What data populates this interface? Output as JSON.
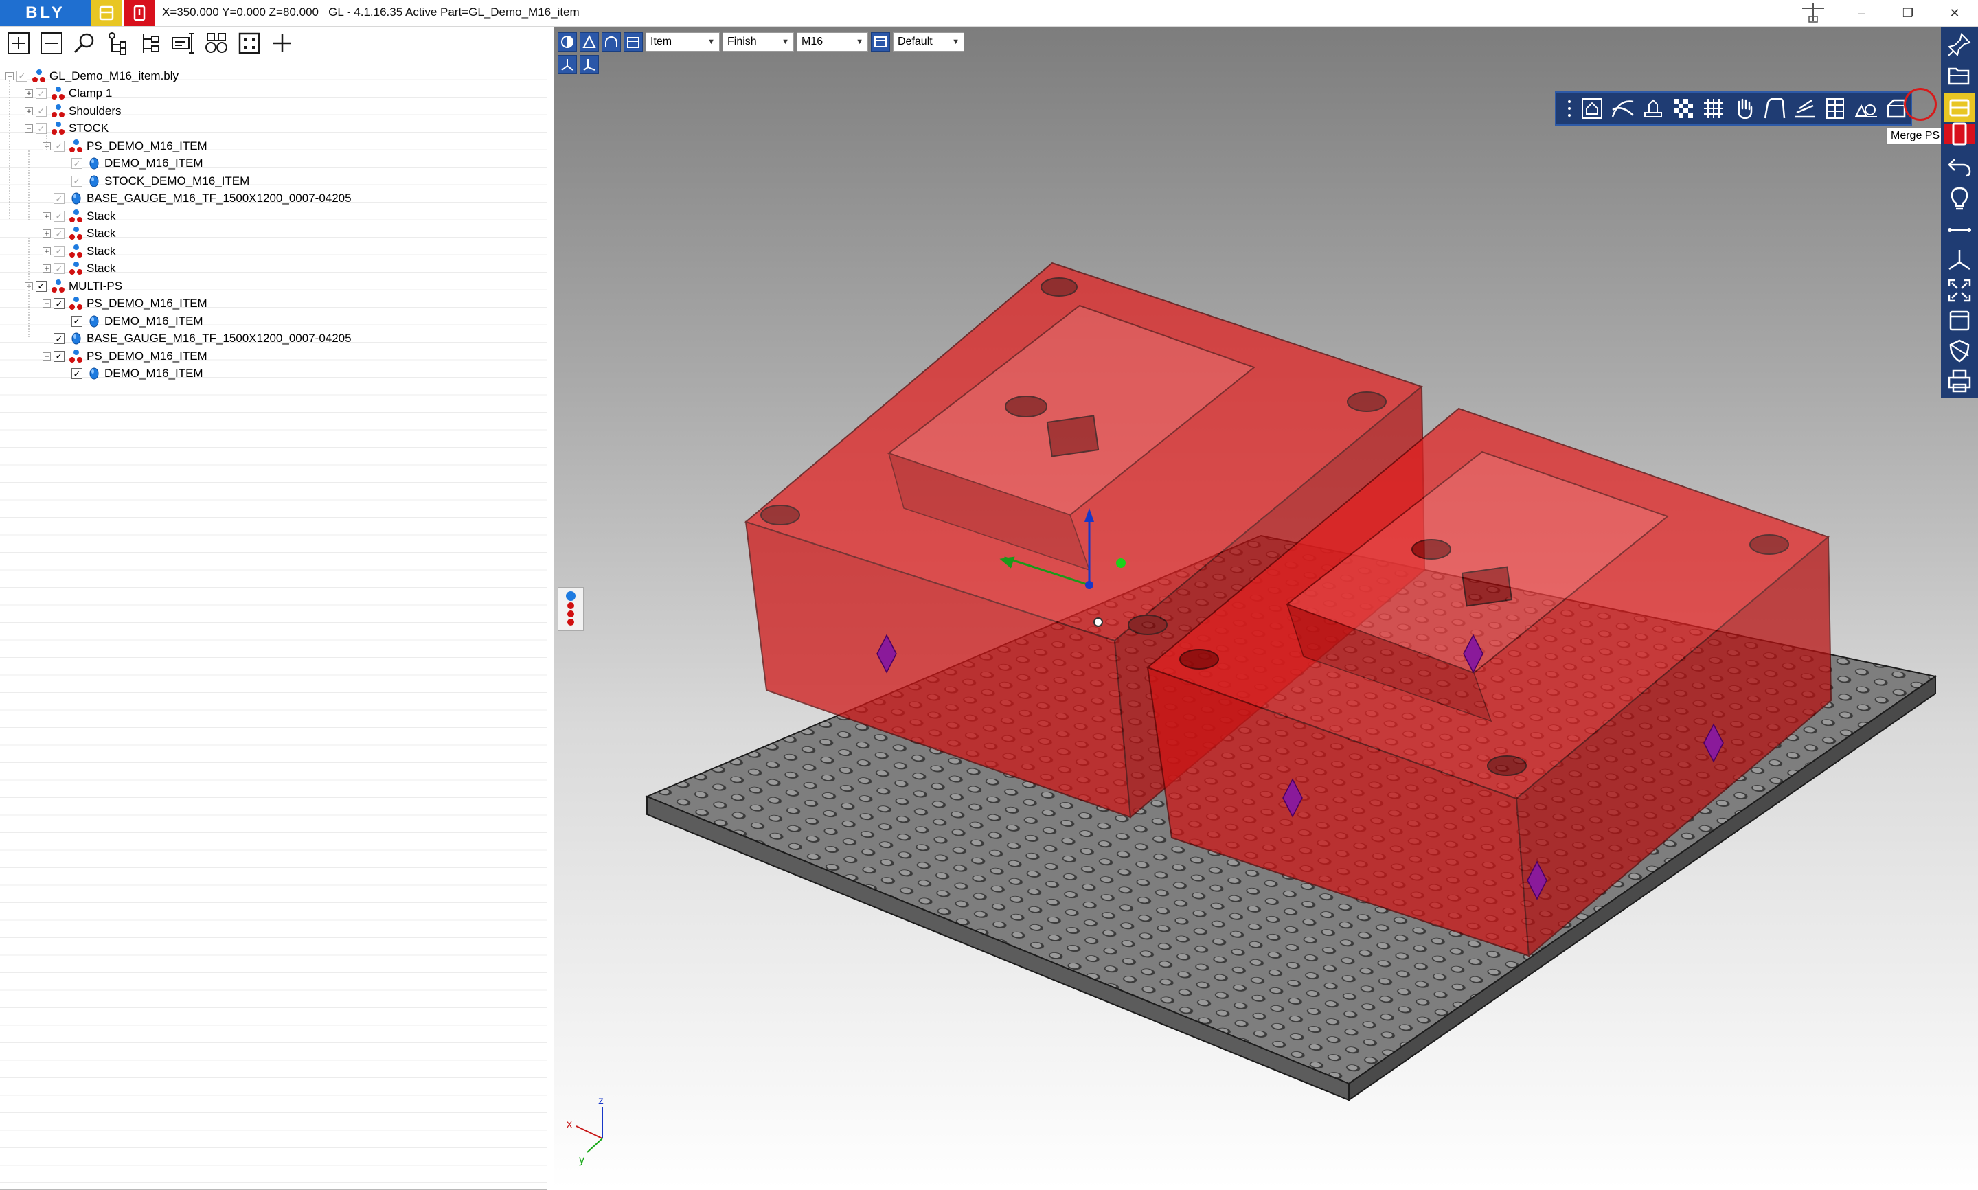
{
  "app": {
    "logo_text": "BLY",
    "status_line": "X=350.000 Y=0.000 Z=80.000   GL - 4.1.16.35 Active Part=GL_Demo_M16_item",
    "window_controls": {
      "minimize": "–",
      "restore": "❐",
      "close": "✕"
    }
  },
  "tree_toolbar": {
    "icons": [
      "expand-all-icon",
      "collapse-all-icon",
      "search-icon",
      "tree-select-icon",
      "tree-assign-icon",
      "edit-icon",
      "binoculars-icon",
      "fit-icon",
      "add-icon"
    ]
  },
  "tree": {
    "nodes": [
      {
        "label": "GL_Demo_M16_item.bly",
        "level": 0,
        "expand": "−",
        "checked": false,
        "icon": "assembly"
      },
      {
        "label": "Clamp 1",
        "level": 1,
        "expand": "+",
        "checked": false,
        "icon": "assembly"
      },
      {
        "label": "Shoulders",
        "level": 1,
        "expand": "+",
        "checked": false,
        "icon": "assembly"
      },
      {
        "label": "STOCK",
        "level": 1,
        "expand": "−",
        "checked": false,
        "icon": "assembly"
      },
      {
        "label": "PS_DEMO_M16_ITEM",
        "level": 2,
        "expand": "−",
        "checked": false,
        "icon": "assembly"
      },
      {
        "label": "DEMO_M16_ITEM",
        "level": 3,
        "expand": "",
        "checked": false,
        "icon": "part"
      },
      {
        "label": "STOCK_DEMO_M16_ITEM",
        "level": 3,
        "expand": "",
        "checked": false,
        "icon": "part"
      },
      {
        "label": "BASE_GAUGE_M16_TF_1500X1200_0007-04205",
        "level": 2,
        "expand": "",
        "checked": false,
        "icon": "part"
      },
      {
        "label": "Stack",
        "level": 2,
        "expand": "+",
        "checked": false,
        "icon": "assembly"
      },
      {
        "label": "Stack",
        "level": 2,
        "expand": "+",
        "checked": false,
        "icon": "assembly"
      },
      {
        "label": "Stack",
        "level": 2,
        "expand": "+",
        "checked": false,
        "icon": "assembly"
      },
      {
        "label": "Stack",
        "level": 2,
        "expand": "+",
        "checked": false,
        "icon": "assembly"
      },
      {
        "label": "MULTI-PS",
        "level": 1,
        "expand": "−",
        "checked": true,
        "icon": "assembly"
      },
      {
        "label": "PS_DEMO_M16_ITEM",
        "level": 2,
        "expand": "−",
        "checked": true,
        "icon": "assembly"
      },
      {
        "label": "DEMO_M16_ITEM",
        "level": 3,
        "expand": "",
        "checked": true,
        "icon": "part"
      },
      {
        "label": "BASE_GAUGE_M16_TF_1500X1200_0007-04205",
        "level": 2,
        "expand": "",
        "checked": true,
        "icon": "part"
      },
      {
        "label": "PS_DEMO_M16_ITEM",
        "level": 2,
        "expand": "−",
        "checked": true,
        "icon": "assembly"
      },
      {
        "label": "DEMO_M16_ITEM",
        "level": 3,
        "expand": "",
        "checked": true,
        "icon": "part"
      }
    ]
  },
  "viewport_toolbar": {
    "combos": [
      {
        "value": "Item"
      },
      {
        "value": "Finish"
      },
      {
        "value": "M16"
      },
      {
        "value": "Default"
      }
    ]
  },
  "floating_toolbar": {
    "icons": [
      "grip-icon",
      "fixture-icon",
      "curves-icon",
      "clamp-icon",
      "checker-icon",
      "grid-icon",
      "hand-icon",
      "profile-icon",
      "layers-icon",
      "table-icon",
      "shapes-icon",
      "merge-ps-icon"
    ],
    "tooltip": "Merge PS"
  },
  "right_toolbar": {
    "icons": [
      "pin-icon",
      "open-folder-icon",
      "yellow-panel-icon",
      "red-panel-icon",
      "undo-icon",
      "lightbulb-icon",
      "measure-icon",
      "axes-icon",
      "fit-view-icon",
      "window-icon",
      "shield-icon",
      "print-icon"
    ]
  },
  "axes": {
    "x": "x",
    "y": "y",
    "z": "z"
  },
  "colors": {
    "brand_blue": "#1f6fd0",
    "toolbar_navy": "#1f3c73",
    "part_red": "#e01010",
    "plate_gray": "#7a7a7a",
    "highlight_red": "#d81a1a"
  }
}
